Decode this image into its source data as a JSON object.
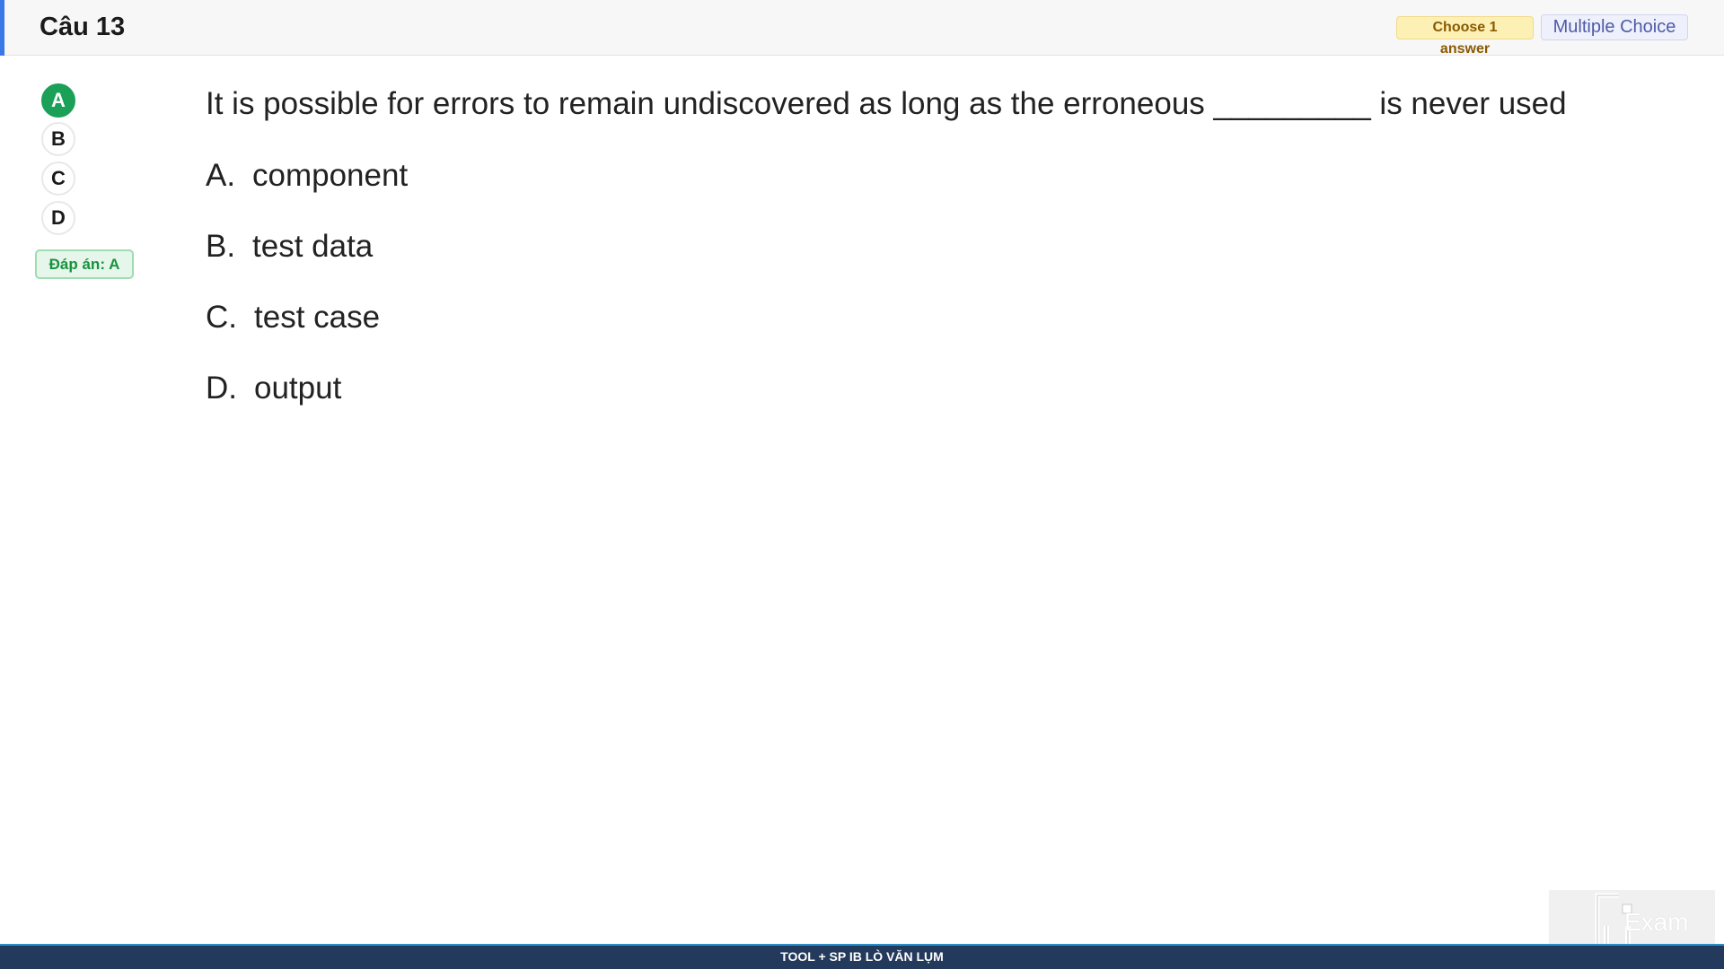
{
  "header": {
    "title": "Câu 13",
    "choose_badge": "Choose 1 answer",
    "type_badge": "Multiple Choice",
    "accent_color": "#3b78e7"
  },
  "answer_panel": {
    "options": [
      {
        "label": "A",
        "selected": true
      },
      {
        "label": "B",
        "selected": false
      },
      {
        "label": "C",
        "selected": false
      },
      {
        "label": "D",
        "selected": false
      }
    ],
    "answer_label": "Đáp án: A",
    "selected_color": "#1aa157"
  },
  "question": {
    "text": "It is possible for errors to remain undiscovered as long as the erroneous _________ is never used",
    "choices": [
      {
        "letter": "A.",
        "text": "component"
      },
      {
        "letter": "B.",
        "text": "test data"
      },
      {
        "letter": "C.",
        "text": "test case"
      },
      {
        "letter": "D.",
        "text": "output"
      }
    ]
  },
  "footer": {
    "text": "TOOL + SP IB LÒ VĂN LỤM",
    "bar_color": "#243a5c"
  },
  "logo": {
    "text": "Exam",
    "icon": "fu-exam-logo"
  }
}
